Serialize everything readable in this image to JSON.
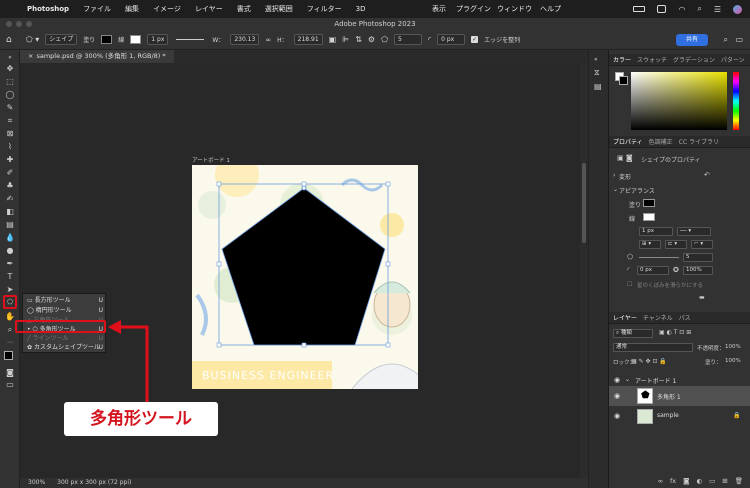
{
  "menubar": {
    "app": "Photoshop",
    "items": [
      "ファイル",
      "編集",
      "イメージ",
      "レイヤー",
      "書式",
      "選択範囲",
      "フィルター",
      "3D"
    ],
    "right": [
      "表示",
      "プラグイン",
      "ウィンドウ",
      "ヘルプ"
    ]
  },
  "window_title": "Adobe Photoshop 2023",
  "options": {
    "mode": "シェイプ",
    "fill_label": "塗り",
    "stroke_label": "線",
    "stroke_width": "1 px",
    "w_label": "W：",
    "w_value": "230.13",
    "h_label": "H：",
    "h_value": "218.91",
    "sides": "5",
    "corner": "0 px",
    "align_edges": "エッジを整列",
    "share": "共有"
  },
  "document_tab": "sample.psd @ 300% (多角形 1, RGB/8) *",
  "artboard_label": "アートボード 1",
  "artboard_banner": "BUSINESS ENGINEER",
  "status": "300%　　300 px x 300 px (72 ppi)",
  "flyout": [
    {
      "label": "長方形ツール",
      "key": "U"
    },
    {
      "label": "楕円形ツール",
      "key": "U"
    },
    {
      "label": "三角形ツール",
      "key": "U"
    },
    {
      "label": "多角形ツール",
      "key": "U"
    },
    {
      "label": "ラインツール",
      "key": "U"
    },
    {
      "label": "カスタムシェイプツール",
      "key": "U"
    }
  ],
  "callout": "多角形ツール",
  "color_tabs": [
    "カラー",
    "スウォッチ",
    "グラデーション",
    "パターン"
  ],
  "props_tabs": [
    "プロパティ",
    "色調補正",
    "CC ライブラリ"
  ],
  "props": {
    "subtitle": "シェイプのプロパティ",
    "transform": "変形",
    "appearance": "アピアランス",
    "fill": "塗り",
    "stroke": "線",
    "stroke_width": "1 px",
    "sides": "5",
    "corner": "0 px",
    "percent": "100%",
    "note": "星のくぼみを滑らかにする"
  },
  "layer_tabs": [
    "レイヤー",
    "チャンネル",
    "パス"
  ],
  "layers": {
    "kind": "種類",
    "blend": "通常",
    "opacity_label": "不透明度：",
    "opacity": "100%",
    "lock_label": "ロック：",
    "fill_label": "塗り：",
    "fill": "100%",
    "items": [
      "アートボード 1",
      "多角形 1",
      "sample"
    ]
  }
}
